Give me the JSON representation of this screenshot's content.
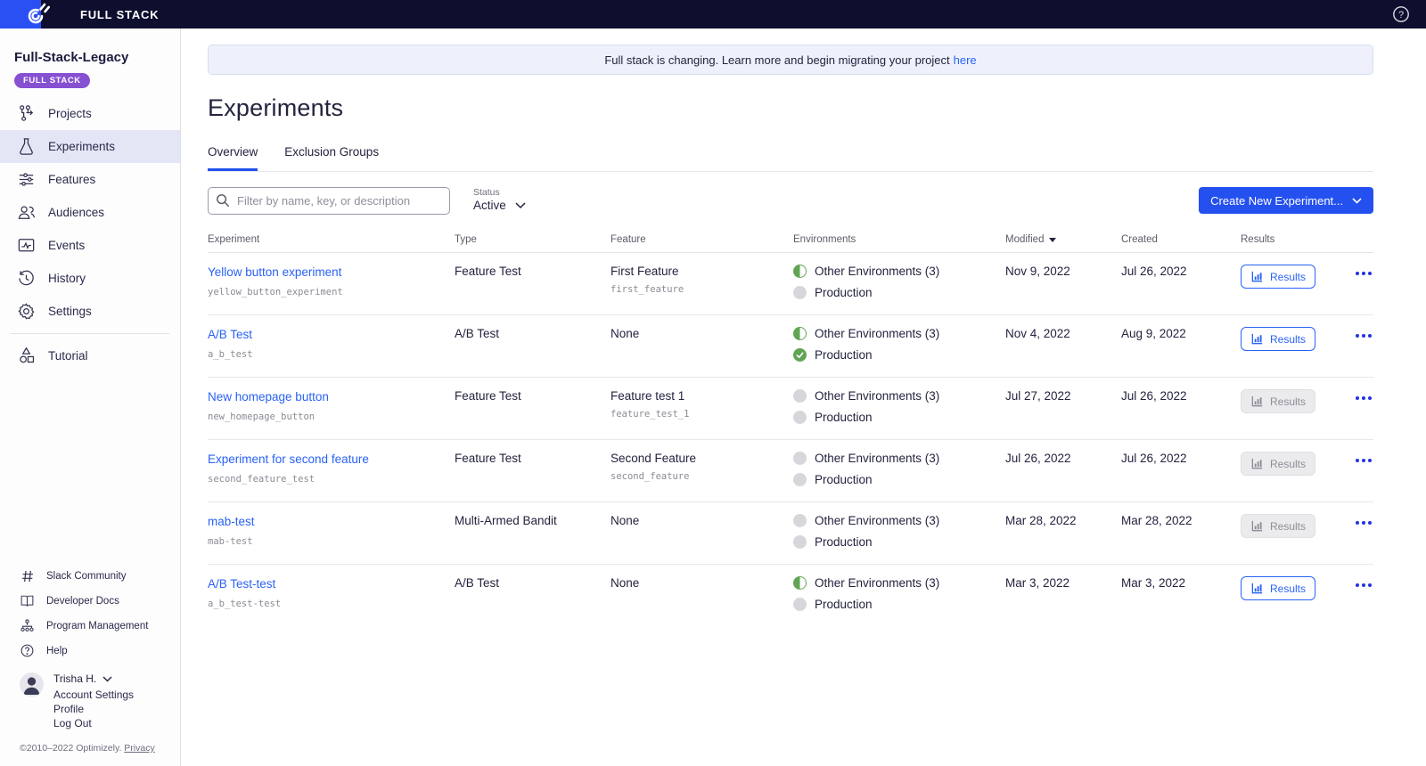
{
  "topbar": {
    "brand": "FULL STACK"
  },
  "sidebar": {
    "project_name": "Full-Stack-Legacy",
    "badge": "FULL STACK",
    "items": [
      {
        "icon": "projects-icon",
        "label": "Projects",
        "active": false
      },
      {
        "icon": "experiments-icon",
        "label": "Experiments",
        "active": true
      },
      {
        "icon": "features-icon",
        "label": "Features",
        "active": false
      },
      {
        "icon": "audiences-icon",
        "label": "Audiences",
        "active": false
      },
      {
        "icon": "events-icon",
        "label": "Events",
        "active": false
      },
      {
        "icon": "history-icon",
        "label": "History",
        "active": false
      },
      {
        "icon": "settings-icon",
        "label": "Settings",
        "active": false
      },
      {
        "icon": "tutorial-icon",
        "label": "Tutorial",
        "active": false,
        "divider_before": true
      }
    ],
    "footer_links": [
      {
        "icon": "hash-icon",
        "label": "Slack Community"
      },
      {
        "icon": "book-icon",
        "label": "Developer Docs"
      },
      {
        "icon": "org-icon",
        "label": "Program Management"
      },
      {
        "icon": "help-icon",
        "label": "Help"
      }
    ],
    "user": {
      "name": "Trisha H.",
      "links": [
        "Account Settings",
        "Profile",
        "Log Out"
      ]
    },
    "copyright": "©2010–2022 Optimizely.",
    "privacy_label": "Privacy"
  },
  "banner": {
    "text": "Full stack is changing. Learn more and begin migrating your project",
    "link_label": "here"
  },
  "page": {
    "title": "Experiments"
  },
  "tabs": [
    {
      "label": "Overview",
      "active": true
    },
    {
      "label": "Exclusion Groups",
      "active": false
    }
  ],
  "toolbar": {
    "filter_placeholder": "Filter by name, key, or description",
    "status_label": "Status",
    "status_value": "Active",
    "create_button": "Create New Experiment..."
  },
  "table": {
    "columns": [
      "Experiment",
      "Type",
      "Feature",
      "Environments",
      "Modified",
      "Created",
      "Results"
    ],
    "sorted_column": "Modified",
    "results_label": "Results",
    "rows": [
      {
        "name": "Yellow button experiment",
        "key": "yellow_button_experiment",
        "type": "Feature Test",
        "feature": "First Feature",
        "feature_key": "first_feature",
        "environments": [
          {
            "label": "Other Environments (3)",
            "status": "partial"
          },
          {
            "label": "Production",
            "status": "off"
          }
        ],
        "modified": "Nov 9, 2022",
        "created": "Jul 26, 2022",
        "results_enabled": true
      },
      {
        "name": "A/B Test",
        "key": "a_b_test",
        "type": "A/B Test",
        "feature": "None",
        "feature_key": "",
        "environments": [
          {
            "label": "Other Environments (3)",
            "status": "partial"
          },
          {
            "label": "Production",
            "status": "on"
          }
        ],
        "modified": "Nov 4, 2022",
        "created": "Aug 9, 2022",
        "results_enabled": true
      },
      {
        "name": "New homepage button",
        "key": "new_homepage_button",
        "type": "Feature Test",
        "feature": "Feature test 1",
        "feature_key": "feature_test_1",
        "environments": [
          {
            "label": "Other Environments (3)",
            "status": "off"
          },
          {
            "label": "Production",
            "status": "off"
          }
        ],
        "modified": "Jul 27, 2022",
        "created": "Jul 26, 2022",
        "results_enabled": false
      },
      {
        "name": "Experiment for second feature",
        "key": "second_feature_test",
        "type": "Feature Test",
        "feature": "Second Feature",
        "feature_key": "second_feature",
        "environments": [
          {
            "label": "Other Environments (3)",
            "status": "off"
          },
          {
            "label": "Production",
            "status": "off"
          }
        ],
        "modified": "Jul 26, 2022",
        "created": "Jul 26, 2022",
        "results_enabled": false
      },
      {
        "name": "mab-test",
        "key": "mab-test",
        "type": "Multi-Armed Bandit",
        "feature": "None",
        "feature_key": "",
        "environments": [
          {
            "label": "Other Environments (3)",
            "status": "off"
          },
          {
            "label": "Production",
            "status": "off"
          }
        ],
        "modified": "Mar 28, 2022",
        "created": "Mar 28, 2022",
        "results_enabled": false
      },
      {
        "name": "A/B Test-test",
        "key": "a_b_test-test",
        "type": "A/B Test",
        "feature": "None",
        "feature_key": "",
        "environments": [
          {
            "label": "Other Environments (3)",
            "status": "partial"
          },
          {
            "label": "Production",
            "status": "off"
          }
        ],
        "modified": "Mar 3, 2022",
        "created": "Mar 3, 2022",
        "results_enabled": true
      }
    ]
  },
  "colors": {
    "topbar_bg": "#0e0e2e",
    "logo_blue": "#2a4ff2",
    "badge_purple": "#8650d2",
    "accent_blue": "#2450ef",
    "link_blue": "#2962f5",
    "env_green": "#61a454",
    "env_gray": "#d7d7db",
    "active_nav_bg": "#e4e6f6",
    "banner_bg": "#eef1fb"
  }
}
